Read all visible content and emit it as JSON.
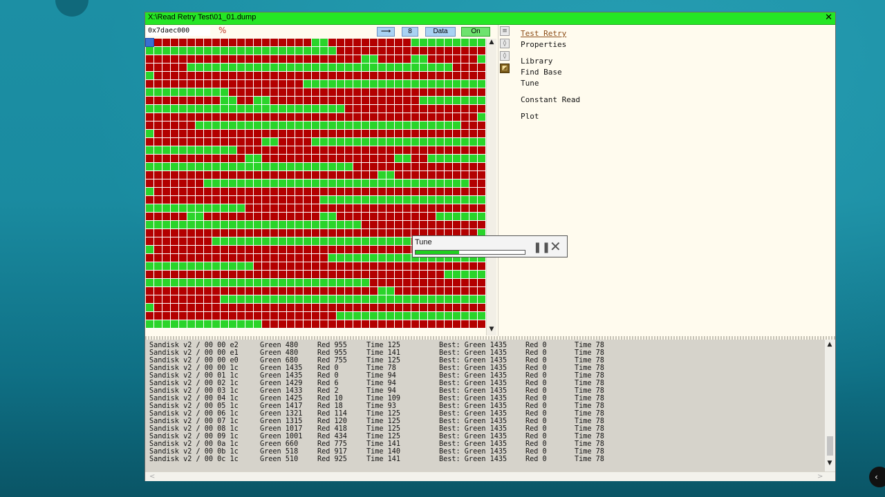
{
  "window": {
    "title": "X:\\Read Retry Test\\01_01.dump",
    "close_glyph": "✕"
  },
  "toolbar": {
    "address": "0x7daec000",
    "percent_icon": "percent-icon",
    "buttons": [
      {
        "name": "arrow-button",
        "label": "⟶"
      },
      {
        "name": "size-button",
        "label": "8"
      },
      {
        "name": "data-button",
        "label": "Data"
      },
      {
        "name": "on-button",
        "label": "On"
      }
    ]
  },
  "colors": {
    "titlebar": "#25e625",
    "cell_green": "#2ad42a",
    "cell_red": "#b30000",
    "link": "#8b4a14",
    "log_bg": "#d6d3cb"
  },
  "grid": {
    "cols": 41,
    "rows": 35,
    "selected_cell": {
      "row": 0,
      "col": 0
    },
    "rows_green_runs": [
      [
        [
          0,
          0
        ],
        [
          20,
          21
        ],
        [
          32,
          40
        ]
      ],
      [
        [
          0,
          22
        ]
      ],
      [
        [
          26,
          27
        ],
        [
          32,
          33
        ],
        [
          40,
          40
        ]
      ],
      [
        [
          5,
          36
        ]
      ],
      [
        [
          0,
          0
        ]
      ],
      [
        [
          19,
          40
        ]
      ],
      [
        [
          0,
          9
        ]
      ],
      [
        [
          9,
          10
        ],
        [
          13,
          14
        ],
        [
          33,
          40
        ]
      ],
      [
        [
          0,
          23
        ]
      ],
      [
        [
          40,
          40
        ]
      ],
      [
        [
          6,
          37
        ]
      ],
      [
        [
          0,
          0
        ]
      ],
      [
        [
          14,
          15
        ],
        [
          20,
          40
        ]
      ],
      [
        [
          0,
          10
        ]
      ],
      [
        [
          12,
          13
        ],
        [
          30,
          31
        ],
        [
          34,
          40
        ]
      ],
      [
        [
          0,
          24
        ]
      ],
      [
        [
          28,
          29
        ]
      ],
      [
        [
          7,
          38
        ]
      ],
      [
        [
          0,
          0
        ]
      ],
      [
        [
          21,
          40
        ]
      ],
      [
        [
          0,
          11
        ]
      ],
      [
        [
          5,
          6
        ],
        [
          21,
          22
        ],
        [
          35,
          40
        ]
      ],
      [
        [
          0,
          25
        ]
      ],
      [
        [
          40,
          40
        ]
      ],
      [
        [
          8,
          31
        ]
      ],
      [
        [
          0,
          0
        ]
      ],
      [
        [
          22,
          40
        ]
      ],
      [
        [
          0,
          12
        ]
      ],
      [
        [
          36,
          40
        ]
      ],
      [
        [
          0,
          26
        ]
      ],
      [
        [
          28,
          29
        ]
      ],
      [
        [
          9,
          40
        ]
      ],
      [
        [
          0,
          0
        ]
      ],
      [
        [
          23,
          40
        ]
      ],
      [
        [
          0,
          13
        ]
      ]
    ]
  },
  "sidebar_icons": [
    "list-icon",
    "pin-icon",
    "pin-alt-icon",
    "tune-active-icon"
  ],
  "menu": {
    "test_retry": "Test Retry",
    "properties": "Properties",
    "library": "Library",
    "find_base": "Find Base",
    "tune": "Tune",
    "constant_read": "Constant Read",
    "plot": "Plot"
  },
  "tune_popup": {
    "label": "Tune",
    "progress": 0.4,
    "pause_glyph": "❚❚",
    "close_glyph": "✕"
  },
  "log": [
    {
      "chip": "Sandisk v2 / 00 00 e2",
      "green": "Green 480",
      "red": "Red 955",
      "time": "Time 125",
      "best": "Best: Green 1435",
      "best_red": "Red 0",
      "best_time": "Time 78"
    },
    {
      "chip": "Sandisk v2 / 00 00 e1",
      "green": "Green 480",
      "red": "Red 955",
      "time": "Time 141",
      "best": "Best: Green 1435",
      "best_red": "Red 0",
      "best_time": "Time 78"
    },
    {
      "chip": "Sandisk v2 / 00 00 e0",
      "green": "Green 680",
      "red": "Red 755",
      "time": "Time 125",
      "best": "Best: Green 1435",
      "best_red": "Red 0",
      "best_time": "Time 78"
    },
    {
      "chip": "Sandisk v2 / 00 00 1c",
      "green": "Green 1435",
      "red": "Red 0",
      "time": "Time 78",
      "best": "Best: Green 1435",
      "best_red": "Red 0",
      "best_time": "Time 78"
    },
    {
      "chip": "Sandisk v2 / 00 01 1c",
      "green": "Green 1435",
      "red": "Red 0",
      "time": "Time 94",
      "best": "Best: Green 1435",
      "best_red": "Red 0",
      "best_time": "Time 78"
    },
    {
      "chip": "Sandisk v2 / 00 02 1c",
      "green": "Green 1429",
      "red": "Red 6",
      "time": "Time 94",
      "best": "Best: Green 1435",
      "best_red": "Red 0",
      "best_time": "Time 78"
    },
    {
      "chip": "Sandisk v2 / 00 03 1c",
      "green": "Green 1433",
      "red": "Red 2",
      "time": "Time 94",
      "best": "Best: Green 1435",
      "best_red": "Red 0",
      "best_time": "Time 78"
    },
    {
      "chip": "Sandisk v2 / 00 04 1c",
      "green": "Green 1425",
      "red": "Red 10",
      "time": "Time 109",
      "best": "Best: Green 1435",
      "best_red": "Red 0",
      "best_time": "Time 78"
    },
    {
      "chip": "Sandisk v2 / 00 05 1c",
      "green": "Green 1417",
      "red": "Red 18",
      "time": "Time 93",
      "best": "Best: Green 1435",
      "best_red": "Red 0",
      "best_time": "Time 78"
    },
    {
      "chip": "Sandisk v2 / 00 06 1c",
      "green": "Green 1321",
      "red": "Red 114",
      "time": "Time 125",
      "best": "Best: Green 1435",
      "best_red": "Red 0",
      "best_time": "Time 78"
    },
    {
      "chip": "Sandisk v2 / 00 07 1c",
      "green": "Green 1315",
      "red": "Red 120",
      "time": "Time 125",
      "best": "Best: Green 1435",
      "best_red": "Red 0",
      "best_time": "Time 78"
    },
    {
      "chip": "Sandisk v2 / 00 08 1c",
      "green": "Green 1017",
      "red": "Red 418",
      "time": "Time 125",
      "best": "Best: Green 1435",
      "best_red": "Red 0",
      "best_time": "Time 78"
    },
    {
      "chip": "Sandisk v2 / 00 09 1c",
      "green": "Green 1001",
      "red": "Red 434",
      "time": "Time 125",
      "best": "Best: Green 1435",
      "best_red": "Red 0",
      "best_time": "Time 78"
    },
    {
      "chip": "Sandisk v2 / 00 0a 1c",
      "green": "Green 660",
      "red": "Red 775",
      "time": "Time 141",
      "best": "Best: Green 1435",
      "best_red": "Red 0",
      "best_time": "Time 78"
    },
    {
      "chip": "Sandisk v2 / 00 0b 1c",
      "green": "Green 518",
      "red": "Red 917",
      "time": "Time 140",
      "best": "Best: Green 1435",
      "best_red": "Red 0",
      "best_time": "Time 78"
    },
    {
      "chip": "Sandisk v2 / 00 0c 1c",
      "green": "Green 510",
      "red": "Red 925",
      "time": "Time 141",
      "best": "Best: Green 1435",
      "best_red": "Red 0",
      "best_time": "Time 78"
    }
  ]
}
